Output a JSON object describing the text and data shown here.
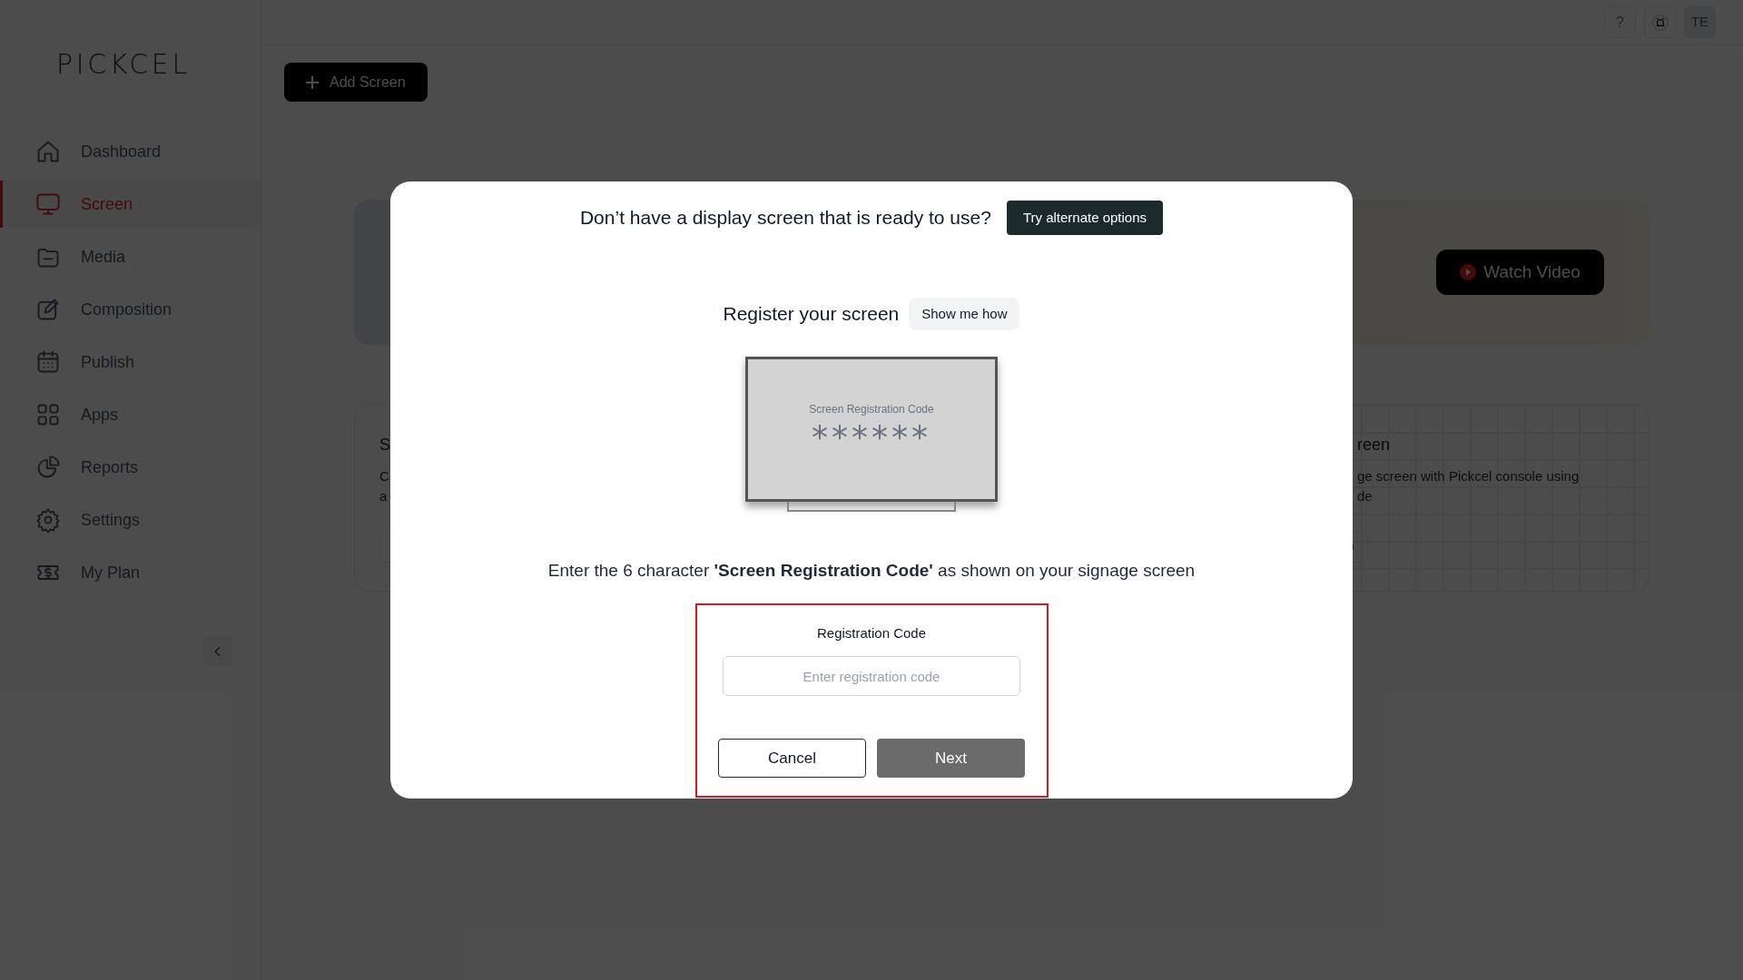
{
  "sidebar": {
    "logo": "PICKCEL",
    "items": [
      {
        "label": "Dashboard",
        "selected": false
      },
      {
        "label": "Screen",
        "selected": true
      },
      {
        "label": "Media",
        "selected": false
      },
      {
        "label": "Composition",
        "selected": false
      },
      {
        "label": "Publish",
        "selected": false
      },
      {
        "label": "Apps",
        "selected": false
      },
      {
        "label": "Reports",
        "selected": false
      },
      {
        "label": "Settings",
        "selected": false
      },
      {
        "label": "My Plan",
        "selected": false
      }
    ]
  },
  "header": {
    "help": "?",
    "avatar": "TE"
  },
  "add_button": "Add Screen",
  "banner": {
    "watch_video": "Watch Video"
  },
  "cards": [
    {
      "title": "S",
      "lines": [
        "C",
        "a"
      ]
    },
    {
      "title": "reen",
      "lines": [
        "ge screen with Pickcel console using",
        "de"
      ]
    }
  ],
  "modal": {
    "prompt": "Don’t have a display screen that is ready to use?",
    "alternate_button": "Try alternate options",
    "register_title": "Register your screen",
    "show_me_how": "Show me how",
    "tv_label": "Screen Registration Code",
    "tv_code": "******",
    "instruction": "Enter the 6 character **'Screen Registration Code'** as shown on your signage screen",
    "field_label": "Registration Code",
    "placeholder": "Enter registration code",
    "cancel": "Cancel",
    "next": "Next"
  }
}
